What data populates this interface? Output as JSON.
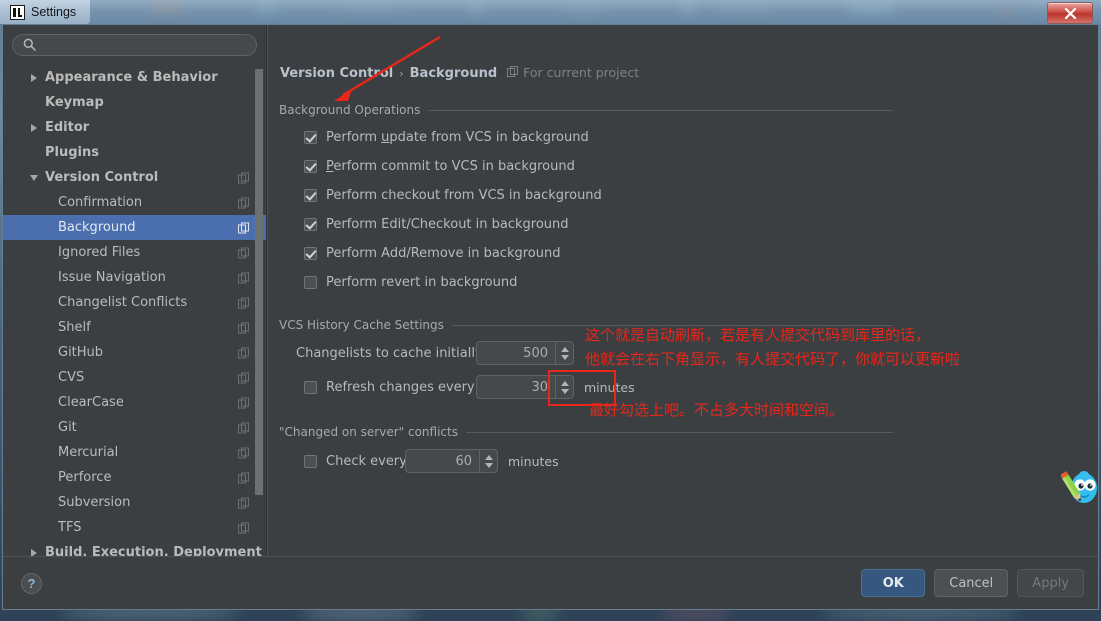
{
  "window": {
    "title": "Settings",
    "logo_icon": "intellij-idea-logo-icon",
    "close_icon": "close-icon"
  },
  "sidebar": {
    "search": {
      "value": "",
      "placeholder": "",
      "icon": "search-icon"
    },
    "items": [
      {
        "label": "Appearance & Behavior",
        "level": 0,
        "twisty": "collapsed",
        "copy": false,
        "selected": false
      },
      {
        "label": "Keymap",
        "level": 0,
        "twisty": "none",
        "copy": false,
        "selected": false
      },
      {
        "label": "Editor",
        "level": 0,
        "twisty": "collapsed",
        "copy": false,
        "selected": false
      },
      {
        "label": "Plugins",
        "level": 0,
        "twisty": "none",
        "copy": false,
        "selected": false
      },
      {
        "label": "Version Control",
        "level": 0,
        "twisty": "expanded",
        "copy": true,
        "selected": false
      },
      {
        "label": "Confirmation",
        "level": 1,
        "twisty": "none",
        "copy": true,
        "selected": false
      },
      {
        "label": "Background",
        "level": 1,
        "twisty": "none",
        "copy": true,
        "selected": true
      },
      {
        "label": "Ignored Files",
        "level": 1,
        "twisty": "none",
        "copy": true,
        "selected": false
      },
      {
        "label": "Issue Navigation",
        "level": 1,
        "twisty": "none",
        "copy": true,
        "selected": false
      },
      {
        "label": "Changelist Conflicts",
        "level": 1,
        "twisty": "none",
        "copy": true,
        "selected": false
      },
      {
        "label": "Shelf",
        "level": 1,
        "twisty": "none",
        "copy": true,
        "selected": false
      },
      {
        "label": "GitHub",
        "level": 1,
        "twisty": "none",
        "copy": true,
        "selected": false
      },
      {
        "label": "CVS",
        "level": 1,
        "twisty": "none",
        "copy": true,
        "selected": false
      },
      {
        "label": "ClearCase",
        "level": 1,
        "twisty": "none",
        "copy": true,
        "selected": false
      },
      {
        "label": "Git",
        "level": 1,
        "twisty": "none",
        "copy": true,
        "selected": false
      },
      {
        "label": "Mercurial",
        "level": 1,
        "twisty": "none",
        "copy": true,
        "selected": false
      },
      {
        "label": "Perforce",
        "level": 1,
        "twisty": "none",
        "copy": true,
        "selected": false
      },
      {
        "label": "Subversion",
        "level": 1,
        "twisty": "none",
        "copy": true,
        "selected": false
      },
      {
        "label": "TFS",
        "level": 1,
        "twisty": "none",
        "copy": true,
        "selected": false
      }
    ],
    "clipped_item": {
      "label": "Build, Execution, Deployment",
      "twisty": "collapsed"
    }
  },
  "breadcrumb": {
    "parent": "Version Control",
    "separator": "›",
    "current": "Background",
    "scope_icon": "copy-project-icon",
    "scope": "For current project"
  },
  "sections": {
    "background_operations": {
      "title": "Background Operations",
      "checkboxes": [
        {
          "label_pre": "Perform ",
          "mnemonic": "u",
          "label_post": "pdate from VCS in background",
          "checked": true
        },
        {
          "label_pre": "",
          "mnemonic": "P",
          "label_post": "erform commit to VCS in background",
          "checked": true
        },
        {
          "label_pre": "Perform checkout from VCS in background",
          "mnemonic": "",
          "label_post": "",
          "checked": true
        },
        {
          "label_pre": "Perform Edit/Checkout in background",
          "mnemonic": "",
          "label_post": "",
          "checked": true
        },
        {
          "label_pre": "Perform Add/Remove in background",
          "mnemonic": "",
          "label_post": "",
          "checked": true
        },
        {
          "label_pre": "Perform revert in background",
          "mnemonic": "",
          "label_post": "",
          "checked": false
        }
      ]
    },
    "vcs_history_cache": {
      "title": "VCS History Cache Settings",
      "changelists_label": "Changelists to cache initially:",
      "changelists_value": "500",
      "refresh_label": "Refresh changes every",
      "refresh_checked": false,
      "refresh_value": "30",
      "refresh_unit": "minutes"
    },
    "changed_on_server": {
      "title": "\"Changed on server\" conflicts",
      "check_label": "Check every",
      "check_checked": false,
      "check_value": "60",
      "check_unit": "minutes"
    }
  },
  "annotations": {
    "color": "#e8261a",
    "line1": "这个就是自动刷新，若是有人提交代码到库里的话，",
    "line2": "他就会在右下角显示，有人提交代码了，你就可以更新啦",
    "line3": "最好勾选上吧。不占多大时间和空间。"
  },
  "mascot": {
    "icon": "blue-mascot-with-pencil-icon"
  },
  "footer": {
    "help_icon": "help-question-icon",
    "help_label": "?",
    "ok_label": "OK",
    "cancel_label": "Cancel",
    "apply_label": "Apply"
  }
}
